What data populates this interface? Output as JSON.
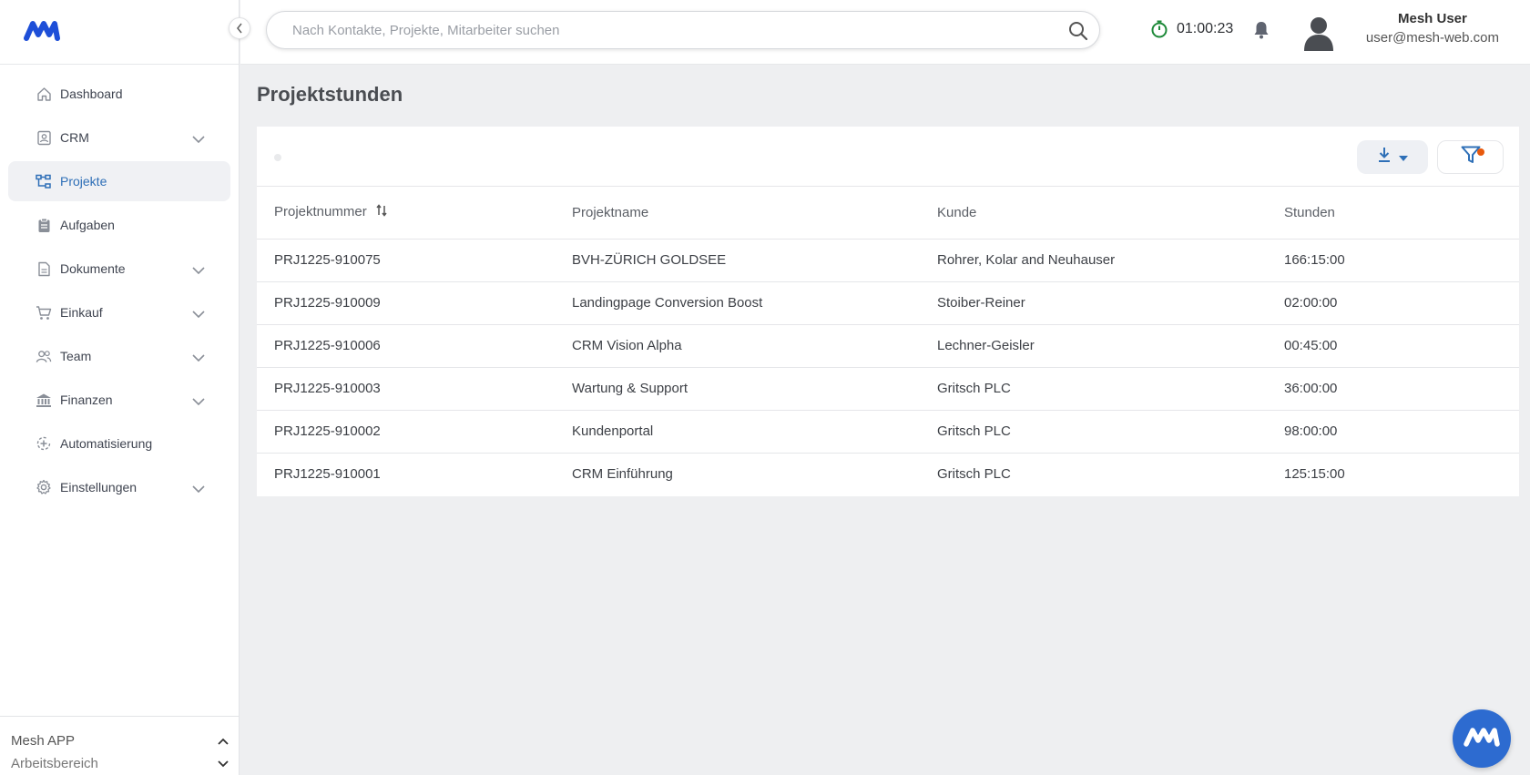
{
  "sidebar": {
    "items": [
      {
        "label": "Dashboard",
        "icon": "home-icon"
      },
      {
        "label": "CRM",
        "icon": "contact-card-icon",
        "expandable": true
      },
      {
        "label": "Projekte",
        "icon": "project-tree-icon",
        "active": true
      },
      {
        "label": "Aufgaben",
        "icon": "clipboard-icon"
      },
      {
        "label": "Dokumente",
        "icon": "document-icon",
        "expandable": true
      },
      {
        "label": "Einkauf",
        "icon": "cart-icon",
        "expandable": true
      },
      {
        "label": "Team",
        "icon": "team-icon",
        "expandable": true
      },
      {
        "label": "Finanzen",
        "icon": "bank-icon",
        "expandable": true
      },
      {
        "label": "Automatisierung",
        "icon": "automation-icon"
      },
      {
        "label": "Einstellungen",
        "icon": "gear-icon",
        "expandable": true
      }
    ],
    "footer": {
      "app": "Mesh APP",
      "workspace": "Arbeitsbereich"
    }
  },
  "header": {
    "search_placeholder": "Nach Kontakte, Projekte, Mitarbeiter suchen",
    "timer": "01:00:23",
    "user_name": "Mesh User",
    "user_email": "user@mesh-web.com"
  },
  "main": {
    "title": "Projektstunden",
    "columns": [
      "Projektnummer",
      "Projektname",
      "Kunde",
      "Stunden"
    ],
    "rows": [
      [
        "PRJ1225-910075",
        "BVH-ZÜRICH GOLDSEE",
        "Rohrer, Kolar and Neuhauser",
        "166:15:00"
      ],
      [
        "PRJ1225-910009",
        "Landingpage Conversion Boost",
        "Stoiber-Reiner",
        "02:00:00"
      ],
      [
        "PRJ1225-910006",
        "CRM Vision Alpha",
        "Lechner-Geisler",
        "00:45:00"
      ],
      [
        "PRJ1225-910003",
        "Wartung & Support",
        "Gritsch PLC",
        "36:00:00"
      ],
      [
        "PRJ1225-910002",
        "Kundenportal",
        "Gritsch PLC",
        "98:00:00"
      ],
      [
        "PRJ1225-910001",
        "CRM Einführung",
        "Gritsch PLC",
        "125:15:00"
      ]
    ]
  },
  "colors": {
    "accent": "#2e6fb7",
    "fab": "#2d6bd0",
    "timer": "#1f8a3a",
    "filter_badge": "#e8590c"
  }
}
